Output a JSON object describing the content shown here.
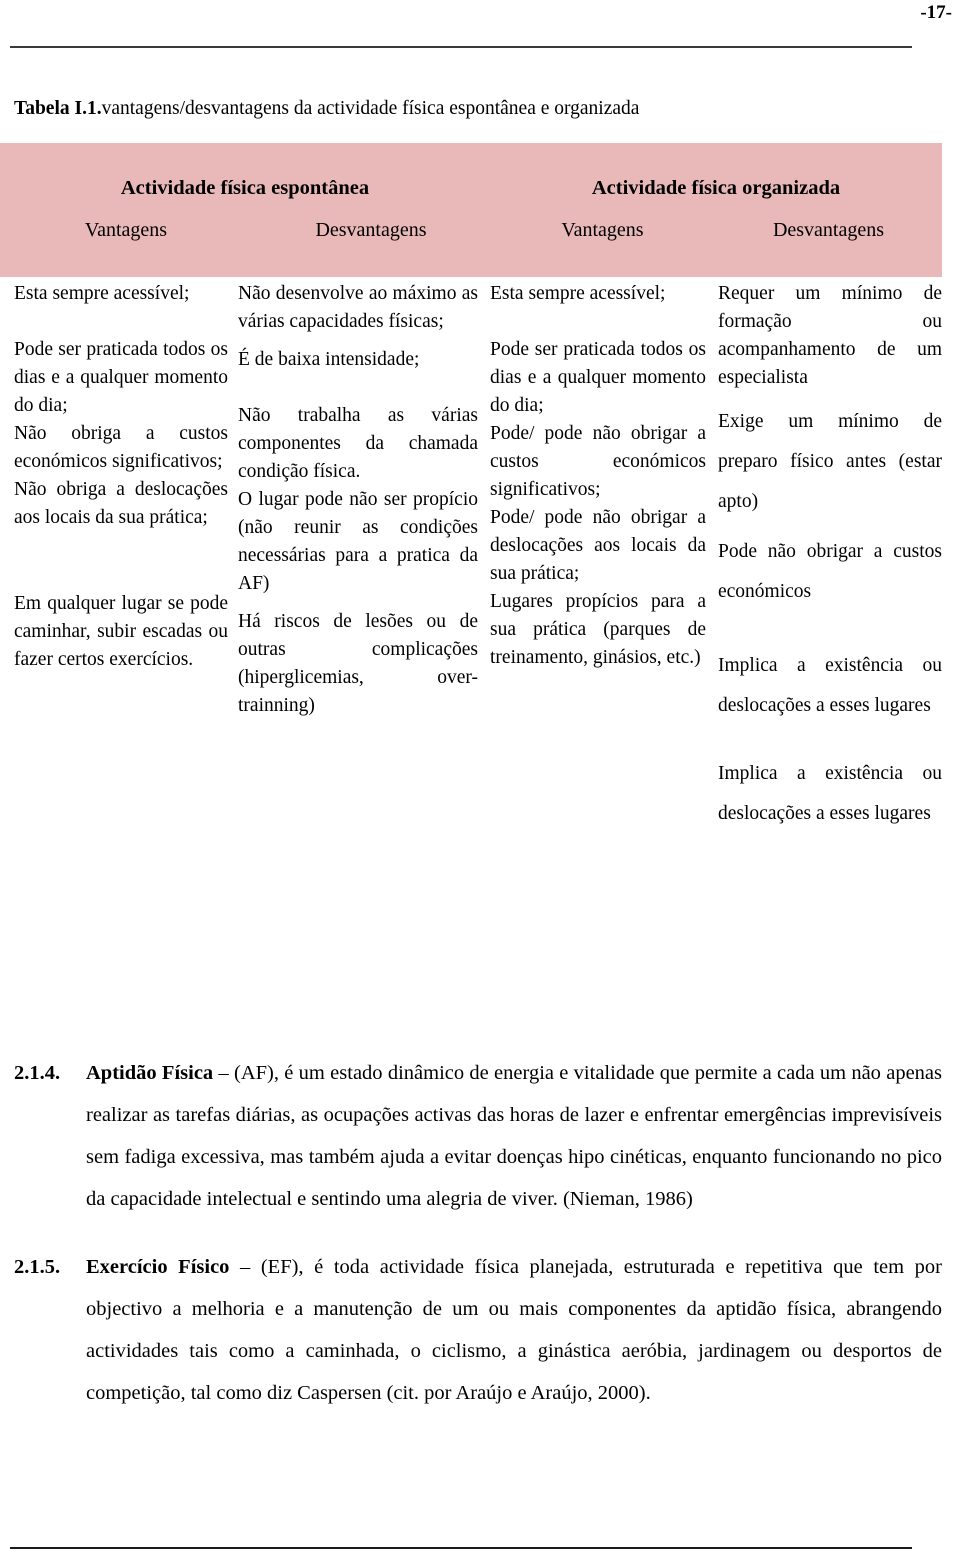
{
  "page": {
    "number": "-17-"
  },
  "caption": {
    "label": "Tabela I.1.",
    "text": "vantagens/desvantagens da actividade física espontânea e organizada"
  },
  "table": {
    "group_headers": [
      "Actividade física espontânea",
      "Actividade física organizada"
    ],
    "column_headers": [
      "Vantagens",
      "Desvantagens",
      "Vantagens",
      "Desvantagens"
    ],
    "columns": {
      "espontanea_vantagens": [
        "Esta sempre acessível;",
        "Pode ser praticada todos os dias e a qualquer momento do dia;",
        "Não obriga a custos económicos significativos;",
        "Não obriga a deslocações aos locais da sua prática;",
        "Em qualquer lugar se pode caminhar, subir escadas ou fazer certos exercícios."
      ],
      "espontanea_desvantagens": [
        "Não desenvolve ao máximo as várias capacidades físicas;",
        "É de baixa intensidade;",
        "Não trabalha as várias componentes da chamada condição física.",
        "O lugar pode não ser propício (não reunir as condições necessárias para a pratica da AF)",
        " Há riscos de lesões ou de outras complicações (hiperglicemias, over-trainning)"
      ],
      "organizada_vantagens": [
        "Esta sempre acessível;",
        "Pode ser praticada todos os dias e a qualquer momento do dia;",
        "Pode/ pode não obrigar a custos económicos significativos;",
        "Pode/ pode não obrigar a deslocações aos locais da sua prática;",
        "Lugares propícios para a sua prática (parques de treinamento, ginásios, etc.)"
      ],
      "organizada_desvantagens": [
        "Requer um mínimo de formação ou acompanhamento de um especialista",
        "Exige um mínimo de preparo físico antes (estar apto)",
        "Pode não obrigar a custos económicos",
        "Implica a existência ou deslocações a esses lugares",
        "Implica a existência ou deslocações a esses lugares"
      ]
    }
  },
  "sections": [
    {
      "number": "2.1.4.",
      "title": "Aptidão Física",
      "body": " – (AF), é um estado dinâmico de energia e vitalidade que permite a cada um não apenas realizar as tarefas diárias, as ocupações activas das horas de lazer e enfrentar emergências imprevisíveis sem fadiga excessiva, mas também ajuda a evitar doenças hipo cinéticas, enquanto funcionando no pico da capacidade intelectual e sentindo uma alegria de viver. (Nieman, 1986)"
    },
    {
      "number": "2.1.5.",
      "title": "Exercício Físico",
      "body": " – (EF), é toda actividade física planejada, estruturada e repetitiva que tem por objectivo a melhoria e a manutenção de um ou mais componentes da aptidão física, abrangendo actividades tais como a caminhada, o ciclismo, a ginástica aeróbia, jardinagem ou desportos de competição, tal como diz Caspersen (cit. por Araújo e Araújo, 2000)."
    }
  ],
  "colors": {
    "table_header_background": "#e9b8b8",
    "text": "#000000",
    "rule": "#3a3a3a"
  }
}
